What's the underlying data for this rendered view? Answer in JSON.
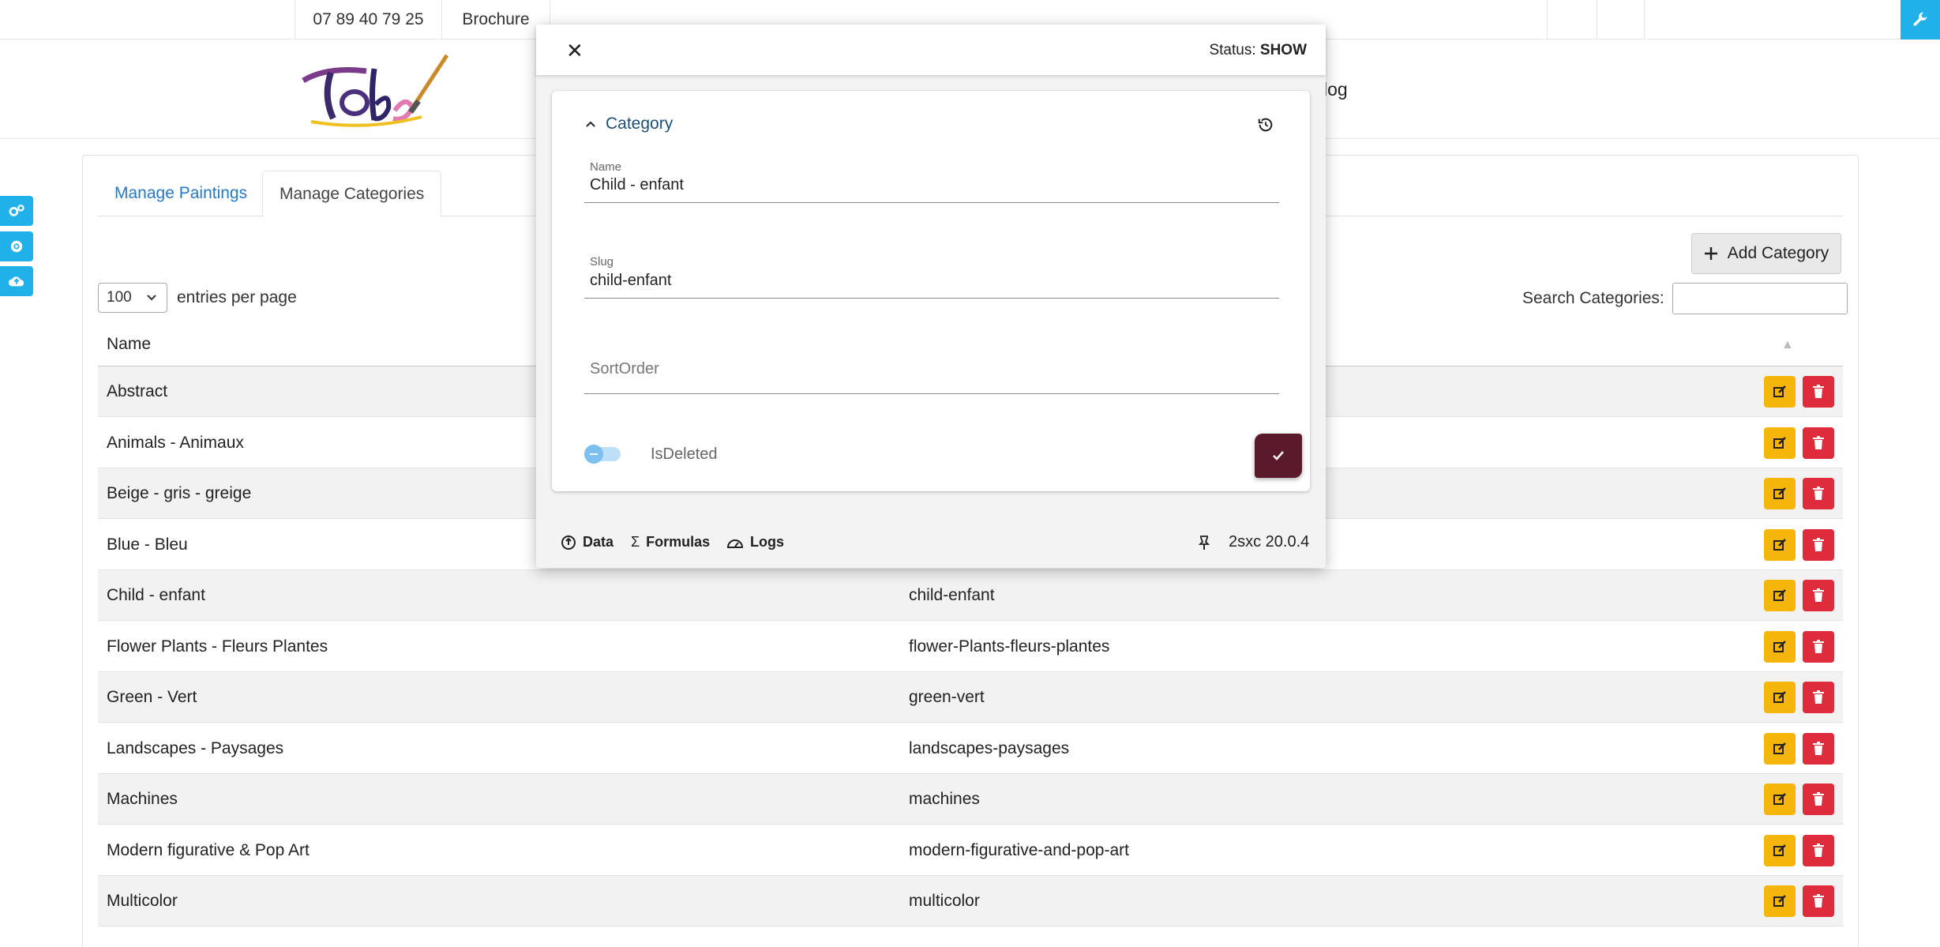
{
  "topbar": {
    "phone": "07 89 40 79 25",
    "brochure": "Brochure"
  },
  "header": {
    "nav_partial": "log"
  },
  "tabs": [
    {
      "label": "Manage Paintings"
    },
    {
      "label": "Manage Categories"
    }
  ],
  "toolbar": {
    "add_label": "Add Category"
  },
  "table_controls": {
    "page_size": "100",
    "entries_label": "entries per page",
    "search_label": "Search Categories:",
    "search_value": ""
  },
  "table": {
    "header_name": "Name",
    "rows": [
      {
        "name": "Abstract",
        "slug": ""
      },
      {
        "name": "Animals - Animaux",
        "slug": ""
      },
      {
        "name": "Beige - gris - greige",
        "slug": ""
      },
      {
        "name": "Blue - Bleu",
        "slug": ""
      },
      {
        "name": "Child - enfant",
        "slug": "child-enfant"
      },
      {
        "name": "Flower Plants - Fleurs Plantes",
        "slug": "flower-Plants-fleurs-plantes"
      },
      {
        "name": "Green - Vert",
        "slug": "green-vert"
      },
      {
        "name": "Landscapes - Paysages",
        "slug": "landscapes-paysages"
      },
      {
        "name": "Machines",
        "slug": "machines"
      },
      {
        "name": "Modern figurative & Pop Art",
        "slug": "modern-figurative-and-pop-art"
      },
      {
        "name": "Multicolor",
        "slug": "multicolor"
      }
    ]
  },
  "dialog": {
    "status_label": "Status:",
    "status_value": "SHOW",
    "group_title": "Category",
    "fields": {
      "name": {
        "label": "Name",
        "value": "Child - enfant"
      },
      "slug": {
        "label": "Slug",
        "value": "child-enfant"
      },
      "sort_order": {
        "placeholder": "SortOrder",
        "value": ""
      },
      "is_deleted": {
        "label": "IsDeleted",
        "checked": false
      }
    },
    "footer": {
      "data": "Data",
      "formulas": "Formulas",
      "logs": "Logs",
      "version": "2sxc 20.0.4"
    }
  },
  "colors": {
    "accent": "#1fb1e8",
    "edit": "#f5b50a",
    "delete": "#de2c3d",
    "save": "#5a1a2c",
    "link": "#2679c5"
  },
  "icons": [
    "wrench-icon",
    "cogs-icon",
    "gear-icon",
    "cloud-upload-icon",
    "plus-icon",
    "edit-icon",
    "trash-icon",
    "close-icon",
    "chevron-up-icon",
    "history-icon",
    "check-icon",
    "data-icon",
    "sigma-icon",
    "logs-icon",
    "pin-icon"
  ]
}
